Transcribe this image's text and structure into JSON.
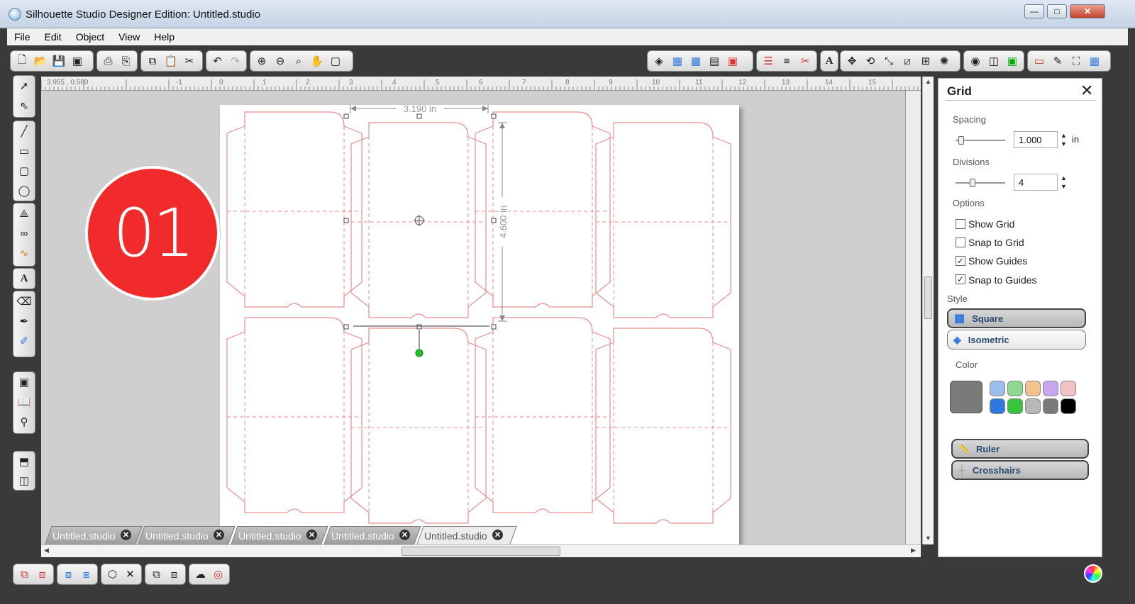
{
  "window": {
    "title": "Silhouette Studio Designer Edition: Untitled.studio",
    "minimize": "—",
    "maximize": "□",
    "close": "✕"
  },
  "menu": [
    "File",
    "Edit",
    "Object",
    "View",
    "Help"
  ],
  "canvas": {
    "coords": "3.955 , 0.560",
    "width_label": "3.190 in",
    "height_label": "4.600 in",
    "ruler_ticks": [
      "-1",
      "0",
      "1",
      "2",
      "3",
      "4",
      "5",
      "6",
      "7",
      "8",
      "9",
      "10",
      "11",
      "12",
      "13",
      "14",
      "15"
    ]
  },
  "badge": "01",
  "tabs": [
    {
      "label": "Untitled.studio",
      "active": false
    },
    {
      "label": "Untitled.studio",
      "active": false
    },
    {
      "label": "Untitled.studio",
      "active": false
    },
    {
      "label": "Untitled.studio",
      "active": false
    },
    {
      "label": "Untitled.studio",
      "active": true
    }
  ],
  "panel": {
    "title": "Grid",
    "spacing_label": "Spacing",
    "spacing_value": "1.000",
    "spacing_unit": "in",
    "divisions_label": "Divisions",
    "divisions_value": "4",
    "options_label": "Options",
    "options": [
      {
        "label": "Show Grid",
        "checked": false
      },
      {
        "label": "Snap to Grid",
        "checked": false
      },
      {
        "label": "Show Guides",
        "checked": true
      },
      {
        "label": "Snap to Guides",
        "checked": true
      }
    ],
    "style_label": "Style",
    "styles": [
      {
        "label": "Square",
        "selected": true
      },
      {
        "label": "Isometric",
        "selected": false
      }
    ],
    "color_label": "Color",
    "current_color": "#7a7a7a",
    "swatches": [
      "#9fbef0",
      "#8fd88f",
      "#f3c28e",
      "#c9a6f0",
      "#f4c2c2",
      "#2f78e0",
      "#37c63b",
      "#b8b8b8",
      "#7a7a7a",
      "#000000"
    ],
    "ruler_btn": "Ruler",
    "crosshairs_btn": "Crosshairs"
  },
  "colors": {
    "accent_red": "#f12b2b",
    "cut_line": "#e88d8d"
  }
}
